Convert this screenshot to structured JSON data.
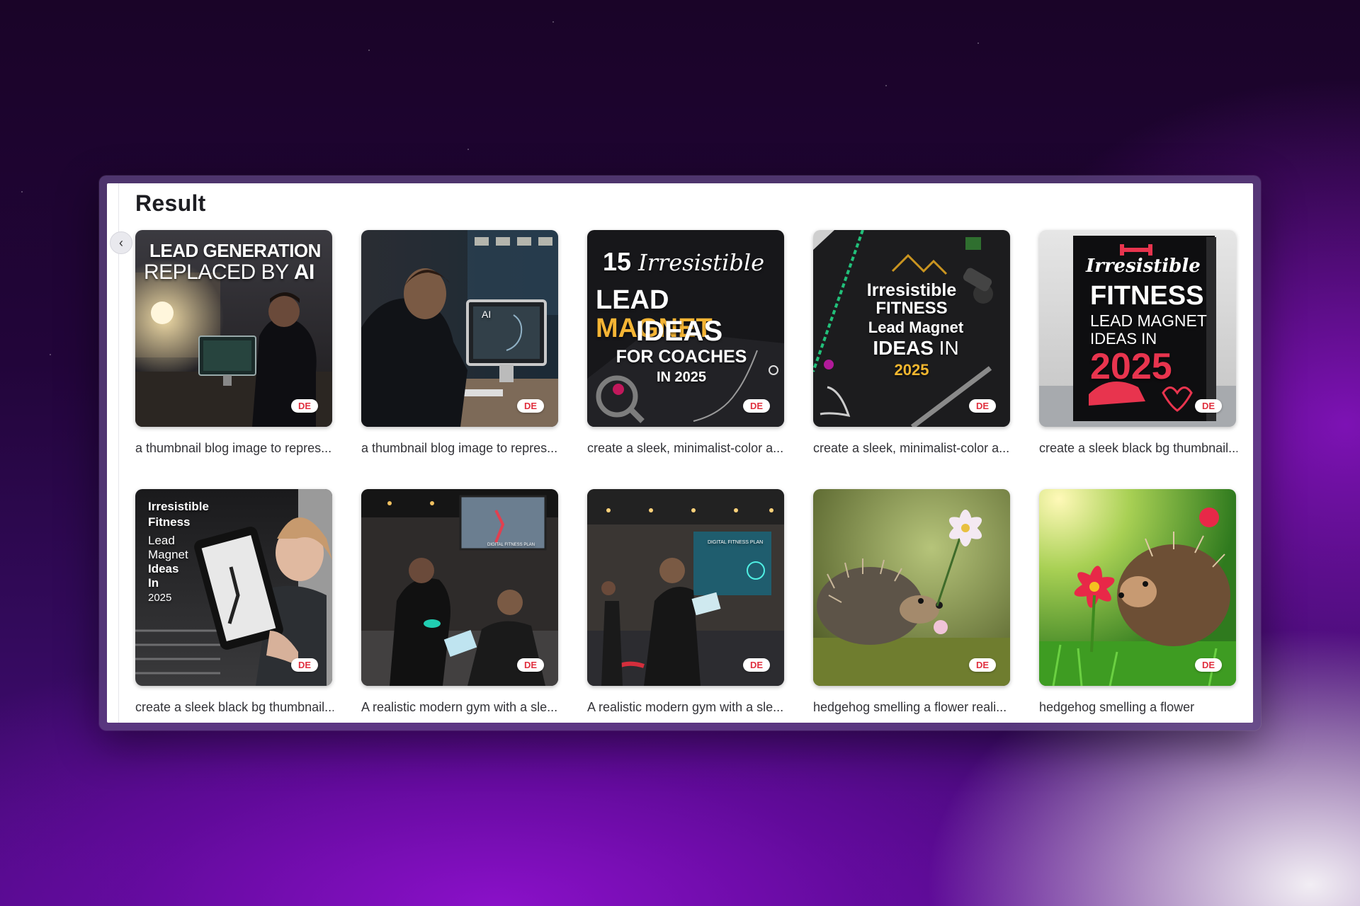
{
  "panel": {
    "title": "Result"
  },
  "cards": [
    {
      "caption": "a thumbnail blog image to repres...",
      "badge": "DE",
      "overlay": {
        "line1": "LEAD GENERATION",
        "line2a": "REPLACED BY ",
        "line2b": "AI"
      }
    },
    {
      "caption": "a thumbnail blog image to repres...",
      "badge": "DE",
      "overlay": {
        "screen": "AI"
      }
    },
    {
      "caption": "create a sleek, minimalist-color a...",
      "badge": "DE",
      "overlay": {
        "line1a": "15 ",
        "line1b": "Irresistible",
        "line2a": "LEAD ",
        "line2b": "MAGNET",
        "line3": "IDEAS",
        "line4": "FOR COACHES",
        "line5": "IN 2025"
      }
    },
    {
      "caption": "create a sleek, minimalist-color a...",
      "badge": "DE",
      "overlay": {
        "line1": "Irresistible",
        "line2": "FITNESS",
        "line3": "Lead Magnet",
        "line4a": "IDEAS",
        "line4b": " IN",
        "line5": "2025"
      }
    },
    {
      "caption": "create a sleek black bg thumbnail...",
      "badge": "DE",
      "overlay": {
        "line1": "Irresistible",
        "line2": "FITNESS",
        "line3": "LEAD MAGNET",
        "line4": "IDEAS IN",
        "line5": "2025"
      }
    },
    {
      "caption": "create a sleek black bg thumbnail...",
      "badge": "DE",
      "overlay": {
        "line1": "Irresistible",
        "line2": "Fitness",
        "line3": "Lead",
        "line4": "Magnet",
        "line5": "Ideas",
        "line6": "In",
        "line7": "2025"
      }
    },
    {
      "caption": "A realistic modern gym with a sle...",
      "badge": "DE",
      "overlay": {
        "screen": "DIGITAL FITNESS PLAN"
      }
    },
    {
      "caption": "A realistic modern gym with a sle...",
      "badge": "DE",
      "overlay": {
        "screen": "DIGITAL FITNESS PLAN"
      }
    },
    {
      "caption": "hedgehog smelling a flower reali...",
      "badge": "DE",
      "overlay": {}
    },
    {
      "caption": "hedgehog smelling a flower",
      "badge": "DE",
      "overlay": {}
    }
  ]
}
